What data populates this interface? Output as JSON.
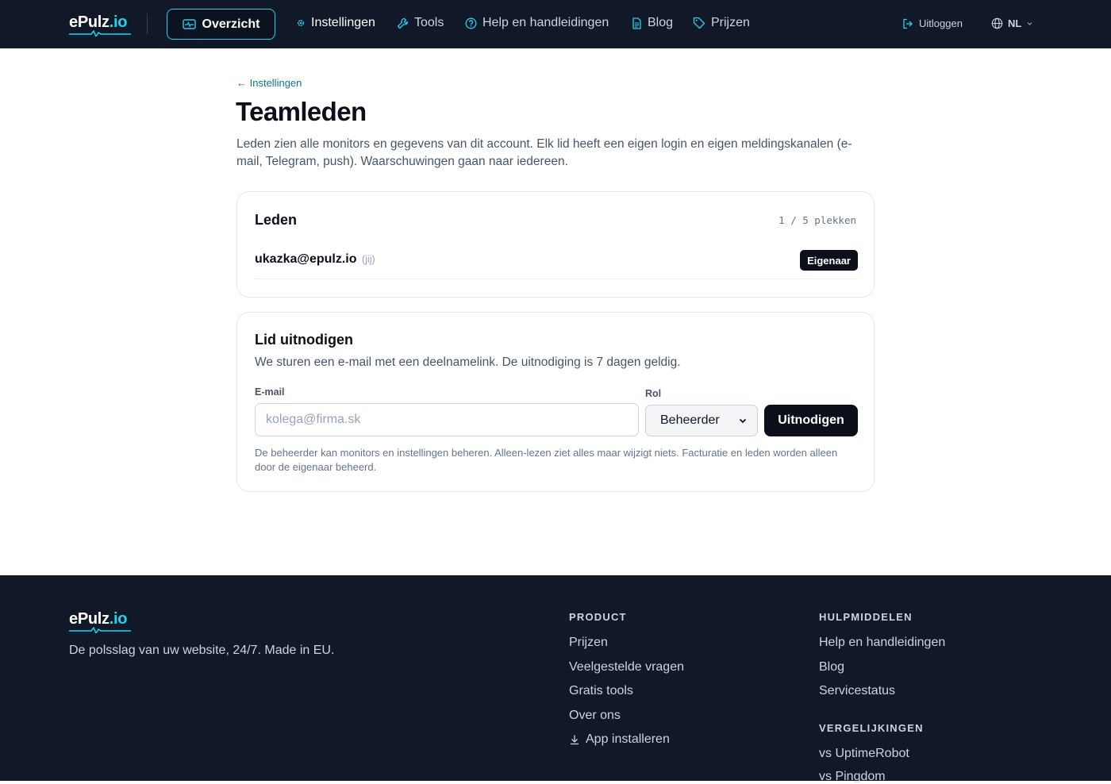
{
  "header": {
    "logo_main": "ePulz",
    "logo_tld": ".io",
    "nav": {
      "overview": "Overzicht",
      "settings": "Instellingen",
      "tools": "Tools",
      "help": "Help en handleidingen",
      "blog": "Blog",
      "pricing": "Prijzen"
    },
    "logout": "Uitloggen",
    "language": "NL"
  },
  "page": {
    "back_link": "← Instellingen",
    "title": "Teamleden",
    "intro": "Leden zien alle monitors en gegevens van dit account. Elk lid heeft een eigen login en eigen meldingskanalen (e-mail, Telegram, push). Waarschuwingen gaan naar iedereen."
  },
  "members": {
    "title": "Leden",
    "seats": "1 / 5 plekken",
    "rows": [
      {
        "email": "ukazka@epulz.io",
        "you": "(jij)",
        "role": "Eigenaar"
      }
    ]
  },
  "invite": {
    "title": "Lid uitnodigen",
    "description": "We sturen een e-mail met een deelnamelink. De uitnodiging is 7 dagen geldig.",
    "email_label": "E-mail",
    "email_placeholder": "kolega@firma.sk",
    "email_value": "",
    "role_label": "Rol",
    "role_selected": "Beheerder",
    "submit_label": "Uitnodigen",
    "hint": "De beheerder kan monitors en instellingen beheren. Alleen-lezen ziet alles maar wijzigt niets. Facturatie en leden worden alleen door de eigenaar beheerd."
  },
  "footer": {
    "logo_main": "ePulz",
    "logo_tld": ".io",
    "tagline": "De polsslag van uw website, 24/7. Made in EU.",
    "product": {
      "title": "PRODUCT",
      "links": [
        "Prijzen",
        "Veelgestelde vragen",
        "Gratis tools",
        "Over ons",
        "App installeren"
      ]
    },
    "resources": {
      "title": "HULPMIDDELEN",
      "links": [
        "Help en handleidingen",
        "Blog",
        "Servicestatus"
      ]
    },
    "comparisons": {
      "title": "VERGELIJKINGEN",
      "links": [
        "vs UptimeRobot",
        "vs Pingdom"
      ]
    }
  },
  "colors": {
    "header_bg": "#111827",
    "accent": "#22d3ee",
    "link": "#0e7490",
    "primary_button": "#0b0f19"
  }
}
